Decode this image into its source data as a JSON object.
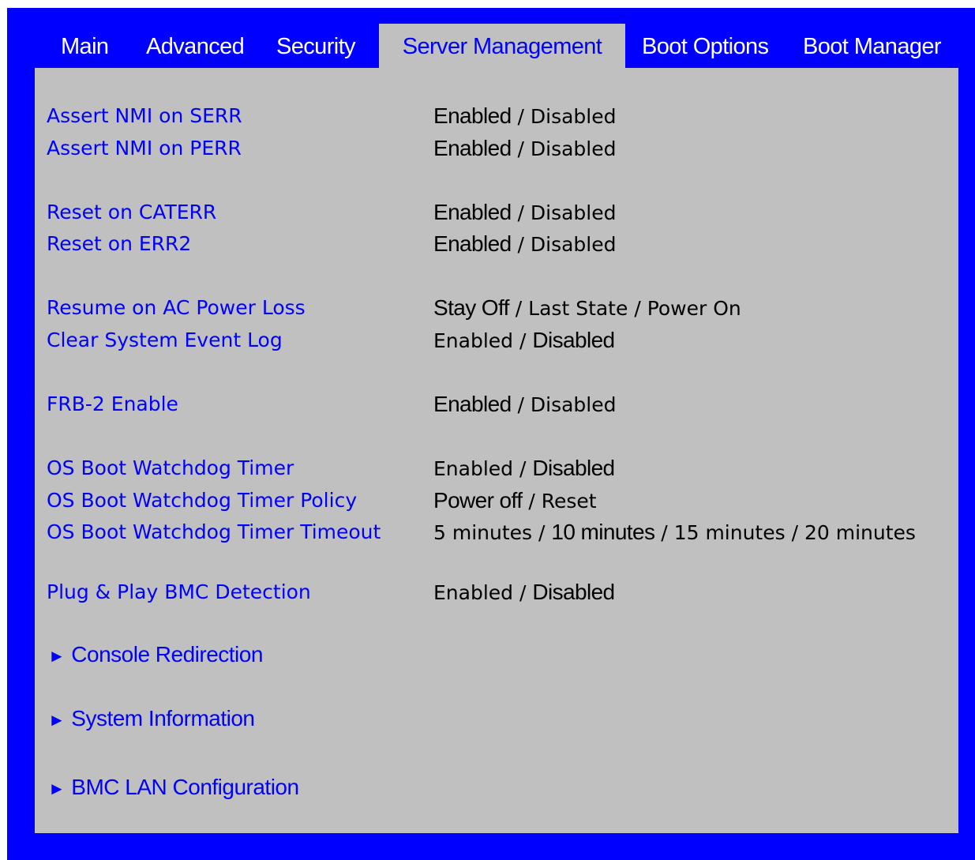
{
  "tabs": [
    {
      "label": "Main",
      "active": false
    },
    {
      "label": "Advanced",
      "active": false
    },
    {
      "label": "Security",
      "active": false
    },
    {
      "label": "Server Management",
      "active": true
    },
    {
      "label": "Boot Options",
      "active": false
    },
    {
      "label": "Boot Manager",
      "active": false
    }
  ],
  "separator": " / ",
  "settings": [
    {
      "label": "Assert NMI on SERR",
      "options": [
        "Enabled",
        "Disabled"
      ],
      "selected": 0
    },
    {
      "label": "Assert NMI on PERR",
      "options": [
        "Enabled",
        "Disabled"
      ],
      "selected": 0
    },
    {
      "label": "Reset on CATERR",
      "options": [
        "Enabled",
        "Disabled"
      ],
      "selected": 0
    },
    {
      "label": "Reset on ERR2",
      "options": [
        "Enabled",
        "Disabled"
      ],
      "selected": 0
    },
    {
      "label": "Resume on AC Power Loss",
      "options": [
        "Stay Off",
        "Last State",
        "Power On"
      ],
      "selected": 0
    },
    {
      "label": "Clear System Event Log",
      "options": [
        "Enabled",
        "Disabled"
      ],
      "selected": 1
    },
    {
      "label": "FRB-2 Enable",
      "options": [
        "Enabled",
        "Disabled"
      ],
      "selected": 0
    },
    {
      "label": "OS Boot Watchdog Timer",
      "options": [
        "Enabled",
        "Disabled"
      ],
      "selected": 1
    },
    {
      "label": "OS Boot Watchdog Timer Policy",
      "options": [
        "Power off",
        "Reset"
      ],
      "selected": 0
    },
    {
      "label": "OS Boot Watchdog Timer Timeout",
      "options": [
        "5 minutes",
        "10 minutes",
        "15 minutes",
        "20 minutes"
      ],
      "selected": 1
    },
    {
      "label": "Plug & Play BMC Detection",
      "options": [
        "Enabled",
        "Disabled"
      ],
      "selected": 1
    }
  ],
  "submenu_arrow": "►",
  "submenus": [
    {
      "label": "Console Redirection"
    },
    {
      "label": "System Information"
    },
    {
      "label": "BMC LAN Configuration"
    }
  ],
  "colors": {
    "frame": "#0000ff",
    "panel": "#c0c0c0",
    "label": "#0000ff",
    "value": "#000000",
    "tab_text": "#ffffff"
  }
}
